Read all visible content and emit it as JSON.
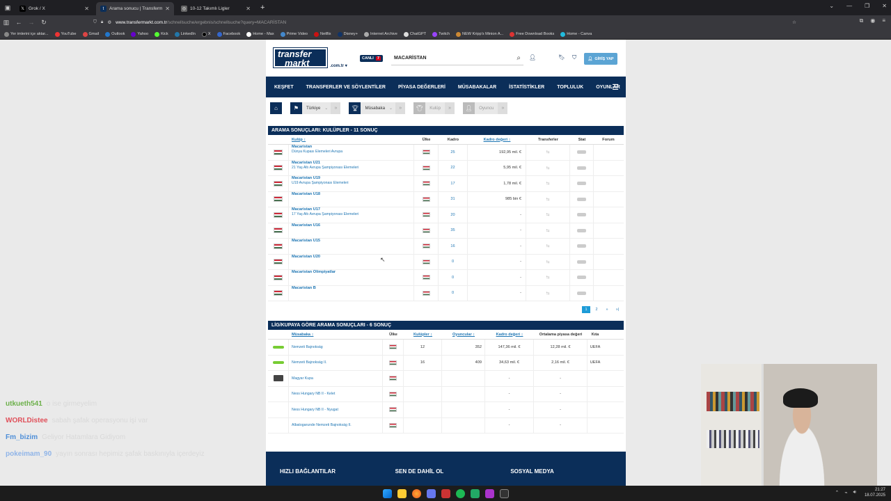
{
  "browser": {
    "tabs": [
      {
        "title": "Grok / X",
        "active": false,
        "icon": "x-icon"
      },
      {
        "title": "Arama sonucu | Transfermarkt",
        "active": true,
        "icon": "transfermarkt-icon"
      },
      {
        "title": "10-12 Takımlı Ligler",
        "active": false,
        "icon": "globe-icon"
      }
    ],
    "new_tab": "+",
    "url_host": "www.transfermarkt.com.tr",
    "url_path": "/schnellsuche/ergebnis/schnellsuche?query=MACARİSTAN",
    "bookmarks": [
      "Yer imlerini içe aktar...",
      "YouTube",
      "Gmail",
      "Outlook",
      "Yahoo",
      "Kick",
      "LinkedIn",
      "X",
      "Facebook",
      "Home - Max",
      "Prime Video",
      "Netflix",
      "Disney+",
      "Internet Archive",
      "ChatGPT",
      "Twitch",
      "NEW Kripp's Minion A...",
      "Free Download Books",
      "Home - Canva"
    ]
  },
  "site": {
    "logo_line1": "transfer",
    "logo_line2": "markt",
    "domain": ".com.tr",
    "live_label": "CANLI",
    "live_count": "7",
    "search_value": "MACARİSTAN",
    "login_label": "GİRİŞ YAP",
    "nav": [
      "KEŞFET",
      "TRANSFERLER VE SÖYLENTİLER",
      "PİYASA DEĞERLERİ",
      "MÜSABAKALAR",
      "İSTATİSTİKLER",
      "TOPLULUK",
      "OYUNLAR"
    ],
    "crumbs": [
      {
        "label": "Türkiye",
        "disabled": false
      },
      {
        "label": "Müsabaka",
        "disabled": false
      },
      {
        "label": "Kulüp",
        "disabled": true
      },
      {
        "label": "Oyuncu",
        "disabled": true
      }
    ]
  },
  "clubs": {
    "title": "ARAMA SONUÇLARI: KULÜPLER - 11 SONUÇ",
    "headers": {
      "club": "Kulüp ↕",
      "country": "Ülke",
      "squad": "Kadro",
      "value": "Kadro değeri ↕",
      "transfers": "Transferler",
      "stat": "Stat",
      "forum": "Forum"
    },
    "rows": [
      {
        "name": "Macaristan",
        "sub": "Dünya Kupası Elemeleri Avrupa",
        "squad": "25",
        "value": "192,95 mil. €"
      },
      {
        "name": "Macaristan U21",
        "sub": "21 Yaş Altı Avrupa Şampiyonası Elemeleri",
        "squad": "22",
        "value": "5,95 mil. €"
      },
      {
        "name": "Macaristan U19",
        "sub": "U19 Avrupa Şampiyonası Elemeleri",
        "squad": "17",
        "value": "1,78 mil. €"
      },
      {
        "name": "Macaristan U18",
        "sub": "",
        "squad": "31",
        "value": "985 bin €"
      },
      {
        "name": "Macaristan U17",
        "sub": "17 Yaş Altı Avrupa Şampiyonası Elemeleri",
        "squad": "20",
        "value": "-"
      },
      {
        "name": "Macaristan U16",
        "sub": "",
        "squad": "35",
        "value": "-"
      },
      {
        "name": "Macaristan U15",
        "sub": "",
        "squad": "16",
        "value": "-"
      },
      {
        "name": "Macaristan U20",
        "sub": "",
        "squad": "0",
        "value": "-"
      },
      {
        "name": "Macaristan Olimpiyatlar",
        "sub": "",
        "squad": "0",
        "value": "-"
      },
      {
        "name": "Macaristan B",
        "sub": "",
        "squad": "0",
        "value": "-"
      }
    ],
    "pages": [
      "1",
      "2",
      "»",
      "»|"
    ]
  },
  "leagues": {
    "title": "LİG/KUPAYA GÖRE ARAMA SONUÇLARI - 6 SONUÇ",
    "headers": {
      "comp": "Müsabaka ↕",
      "country": "Ülke",
      "clubs": "Kulüpler ↕",
      "players": "Oyuncular ↕",
      "value": "Kadro değeri ↕",
      "avg": "Ortalama piyasa değeri",
      "cont": "Kıta"
    },
    "rows": [
      {
        "name": "Nemzeti Bajnokság",
        "clubs": "12",
        "players": "352",
        "value": "147,36 mil. €",
        "avg": "12,28 mil. €",
        "cont": "UEFA",
        "logo": "green"
      },
      {
        "name": "Nemzeti Bajnokság II.",
        "clubs": "16",
        "players": "409",
        "value": "34,63 mil. €",
        "avg": "2,16 mil. €",
        "cont": "UEFA",
        "logo": "green"
      },
      {
        "name": "Magyar Kupa",
        "clubs": "",
        "players": "",
        "value": "-",
        "avg": "-",
        "cont": "",
        "logo": "dark"
      },
      {
        "name": "Ness Hungary NB II - Kelet",
        "clubs": "",
        "players": "",
        "value": "-",
        "avg": "-",
        "cont": "",
        "logo": ""
      },
      {
        "name": "Ness Hungary NB II - Nyugat",
        "clubs": "",
        "players": "",
        "value": "-",
        "avg": "-",
        "cont": "",
        "logo": ""
      },
      {
        "name": "Albatogarunde Nemzeti Bajnokság II.",
        "clubs": "",
        "players": "",
        "value": "-",
        "avg": "-",
        "cont": "",
        "logo": ""
      }
    ]
  },
  "footer": {
    "cols": [
      "HIZLI BAĞLANTILAR",
      "SEN DE DAHİL OL",
      "SOSYAL MEDYA"
    ]
  },
  "chat": [
    {
      "user": "utkueth541",
      "msg": "o ise girmeyelim",
      "color": "#6cb04a"
    },
    {
      "user": "WORLDistee",
      "msg": "sabah şafak operasyonu işi var",
      "color": "#e0505a"
    },
    {
      "user": "Fm_bizim",
      "msg": "Geliyor Hatamlara Gidiyom",
      "color": "#4f8fd8"
    },
    {
      "user": "pokeimam_90",
      "msg": "yayın sonrası hepimiz şafak baskınıyla içerdeyiz",
      "color": "#8fb4e8"
    }
  ],
  "clock": {
    "time": "21:27",
    "date": "18.07.2025"
  }
}
